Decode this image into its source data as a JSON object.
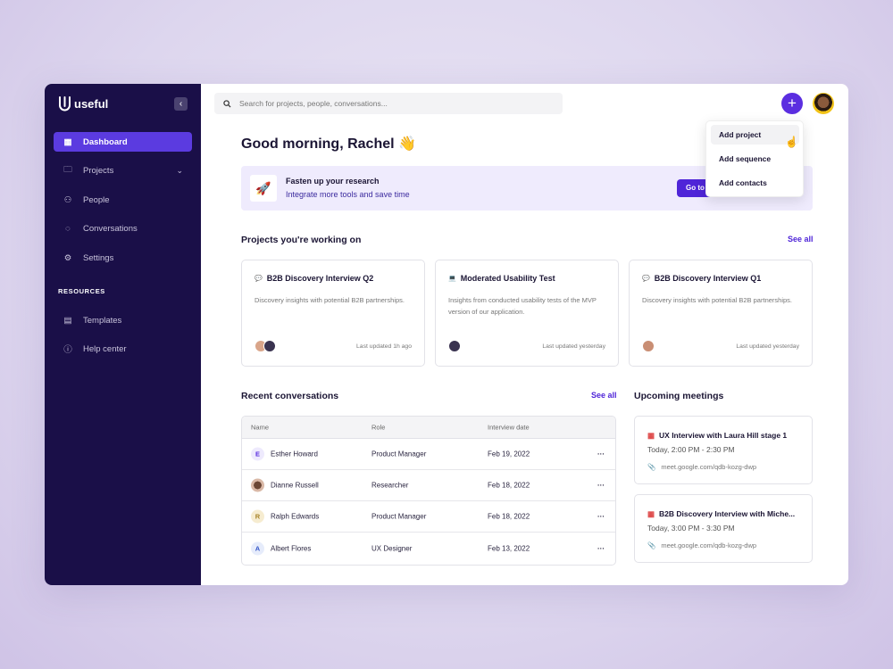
{
  "app": {
    "name": "useful"
  },
  "sidebar": {
    "items": [
      {
        "label": "Dashboard",
        "icon": "dashboard-icon"
      },
      {
        "label": "Projects",
        "icon": "folder-icon"
      },
      {
        "label": "People",
        "icon": "people-icon"
      },
      {
        "label": "Conversations",
        "icon": "chat-icon"
      },
      {
        "label": "Settings",
        "icon": "gear-icon"
      }
    ],
    "section": "RESOURCES",
    "resources": [
      {
        "label": "Templates",
        "icon": "template-icon"
      },
      {
        "label": "Help center",
        "icon": "help-icon"
      }
    ]
  },
  "header": {
    "search_placeholder": "Search for projects, people, conversations..."
  },
  "greeting": "Good morning, Rachel 👋",
  "banner": {
    "title": "Fasten up your research",
    "subtitle": "Integrate more tools and save time",
    "button": "Go to"
  },
  "dropdown": {
    "items": [
      "Add project",
      "Add sequence",
      "Add contacts"
    ]
  },
  "projects": {
    "title": "Projects you're working on",
    "see_all": "See all",
    "items": [
      {
        "icon": "💬",
        "title": "B2B Discovery Interview Q2",
        "desc": "Discovery insights with potential B2B partnerships.",
        "updated": "Last updated 1h ago"
      },
      {
        "icon": "💻",
        "title": "Moderated Usability Test",
        "desc": "Insights from conducted usability tests of the MVP version of our application.",
        "updated": "Last updated yesterday"
      },
      {
        "icon": "💬",
        "title": "B2B Discovery Interview Q1",
        "desc": "Discovery insights with potential B2B partnerships.",
        "updated": "Last updated yesterday"
      }
    ]
  },
  "conversations": {
    "title": "Recent conversations",
    "see_all": "See all",
    "columns": [
      "Name",
      "Role",
      "Interview date"
    ],
    "rows": [
      {
        "initial": "E",
        "name": "Esther Howard",
        "role": "Product Manager",
        "date": "Feb 19, 2022",
        "more": "···"
      },
      {
        "initial": "",
        "name": "Dianne Russell",
        "role": "Researcher",
        "date": "Feb 18, 2022",
        "more": "···"
      },
      {
        "initial": "R",
        "name": "Ralph Edwards",
        "role": "Product Manager",
        "date": "Feb 18, 2022",
        "more": "···"
      },
      {
        "initial": "A",
        "name": "Albert Flores",
        "role": "UX Designer",
        "date": "Feb 13, 2022",
        "more": "···"
      }
    ]
  },
  "meetings": {
    "title": "Upcoming meetings",
    "items": [
      {
        "title": "UX Interview with Laura Hill stage 1",
        "time": "Today, 2:00 PM - 2:30 PM",
        "link": "meet.google.com/qdb-kozg-dwp"
      },
      {
        "title": "B2B Discovery Interview with Miche...",
        "time": "Today, 3:00 PM - 3:30 PM",
        "link": "meet.google.com/qdb-kozg-dwp"
      }
    ]
  },
  "colors": {
    "accent": "#5b2ee0",
    "sidebar": "#1a0f48"
  }
}
